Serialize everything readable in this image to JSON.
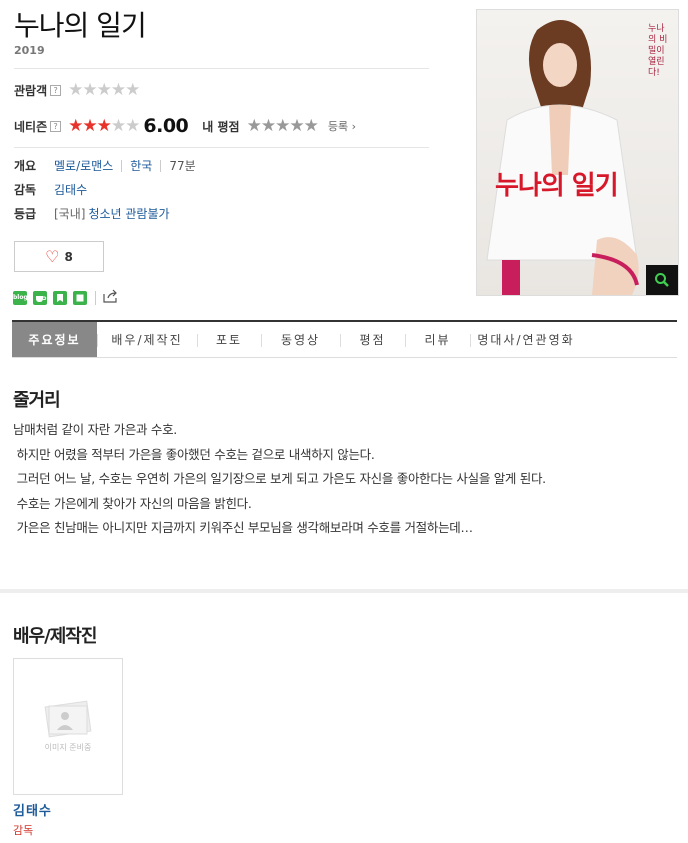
{
  "movie": {
    "title": "누나의 일기",
    "year": "2019",
    "audience_label": "관람객",
    "audience_stars": 0,
    "netizen_label": "네티즌",
    "netizen_stars": 3,
    "netizen_score": "6.00",
    "my_rating_label": "내 평점",
    "my_rating_stars": 0,
    "register_label": "등록 ›",
    "help_glyph": "?",
    "overview_label": "개요",
    "genre": "멜로/로맨스",
    "country": "한국",
    "runtime": "77분",
    "director_label": "감독",
    "director": "김태수",
    "rating_label": "등급",
    "rating_region": "[국내]",
    "rating_value": "청소년 관람불가",
    "likes": "8"
  },
  "poster": {
    "title_text": "누나의 일기",
    "tagline": "누나의 비밀이 열린다!"
  },
  "share": {
    "blog_label": "blog",
    "icons": [
      "blog-icon",
      "cafe-icon",
      "bookmark-icon",
      "memo-icon",
      "share-icon"
    ]
  },
  "tabs": [
    {
      "label": "주요정보",
      "active": true
    },
    {
      "label": "배우/제작진",
      "active": false
    },
    {
      "label": "포토",
      "active": false
    },
    {
      "label": "동영상",
      "active": false
    },
    {
      "label": "평점",
      "active": false
    },
    {
      "label": "리뷰",
      "active": false
    },
    {
      "label": "명대사/연관영화",
      "active": false
    }
  ],
  "synopsis": {
    "heading": "줄거리",
    "lines": [
      "남매처럼 같이 자란 가은과 수호.",
      " 하지만 어렸을 적부터 가은을 좋아했던 수호는 겉으로 내색하지 않는다.",
      " 그러던 어느 날, 수호는 우연히 가은의 일기장으로 보게 되고 가은도 자신을 좋아한다는 사실을 알게 된다.",
      "",
      " 수호는 가은에게 찾아가 자신의 마음을 밝힌다.",
      " 가은은 친남매는 아니지만 지금까지 키워주신 부모님을 생각해보라며 수호를 거절하는데…"
    ]
  },
  "cast": {
    "heading": "배우/제작진",
    "members": [
      {
        "name": "김태수",
        "role": "감독",
        "placeholder": "이미지 준비중"
      }
    ]
  },
  "colors": {
    "accent_red": "#e8332b",
    "link_blue": "#1d5a9a",
    "active_tab_bg": "#888888",
    "share_green": "#3bb34a"
  }
}
